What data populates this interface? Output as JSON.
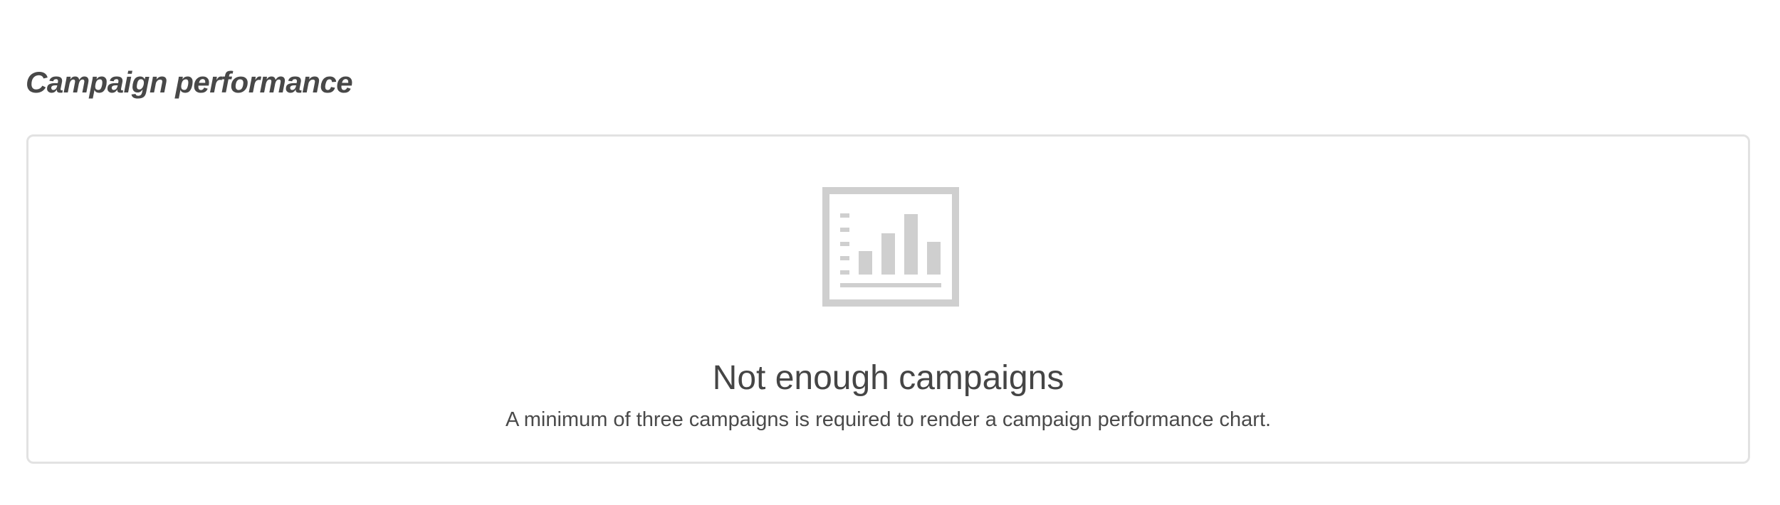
{
  "section": {
    "title": "Campaign performance"
  },
  "empty_state": {
    "icon": "bar-chart-icon",
    "title": "Not enough campaigns",
    "description": "A minimum of three campaigns is required to render a campaign performance chart."
  },
  "colors": {
    "text": "#444444",
    "border": "#e2e2e2",
    "icon": "#cfcfcf"
  }
}
